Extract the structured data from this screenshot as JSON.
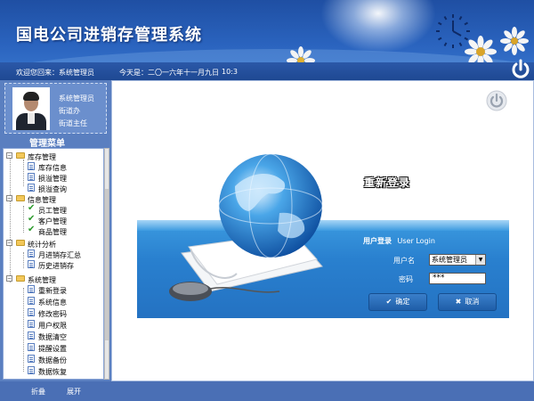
{
  "header": {
    "title": "国电公司进销存管理系统"
  },
  "status": {
    "welcome": "欢迎您回来：系统管理员",
    "today": "今天是：二〇一六年十一月九日",
    "time": "10:3"
  },
  "user": {
    "role": "系统管理员",
    "dept": "街道办",
    "position": "街道主任"
  },
  "menu": {
    "title": "管理菜单",
    "groups": [
      {
        "label": "库存管理",
        "items": [
          "库存信息",
          "损溢管理",
          "损溢查询"
        ]
      },
      {
        "label": "信息管理",
        "items": [
          "员工管理",
          "客户管理",
          "商品管理"
        ]
      },
      {
        "label": "统计分析",
        "items": [
          "月进销存汇总",
          "历史进销存"
        ]
      },
      {
        "label": "系统管理",
        "items": [
          "重新登录",
          "系统信息",
          "修改密码",
          "用户权限",
          "数据清空",
          "提醒设置",
          "数据备份",
          "数据恢复"
        ]
      }
    ]
  },
  "footer": {
    "collapse": "折叠",
    "expand": "展开"
  },
  "login": {
    "banner": "重新登录",
    "heading_cn": "用户登录",
    "heading_en": "User Login",
    "username_label": "用户名",
    "username_value": "系统管理员",
    "password_label": "密码",
    "password_value": "***",
    "ok": "确定",
    "cancel": "取消"
  },
  "colors": {
    "header": "#2a63be",
    "panel": "#5a7fc0",
    "login_band": "#2980cf"
  }
}
